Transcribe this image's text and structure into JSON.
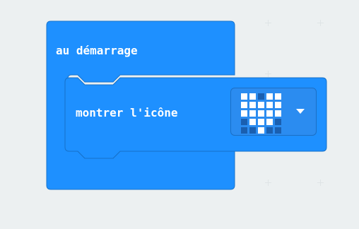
{
  "workspace": {
    "background": "#ecf0f1"
  },
  "on_start_block": {
    "label": "au démarrage",
    "color": "#1e90ff"
  },
  "show_icon_block": {
    "label": "montrer l'icône",
    "color": "#1e90ff",
    "icon_name": "heart-icon",
    "icon_matrix": [
      [
        1,
        1,
        0,
        1,
        1
      ],
      [
        1,
        1,
        1,
        1,
        1
      ],
      [
        1,
        1,
        1,
        1,
        1
      ],
      [
        0,
        1,
        1,
        1,
        0
      ],
      [
        0,
        0,
        1,
        0,
        0
      ]
    ],
    "led_on_color": "#ffffff",
    "led_off_color": "#1a5fb0",
    "dropdown_icon": "chevron-down-icon"
  }
}
